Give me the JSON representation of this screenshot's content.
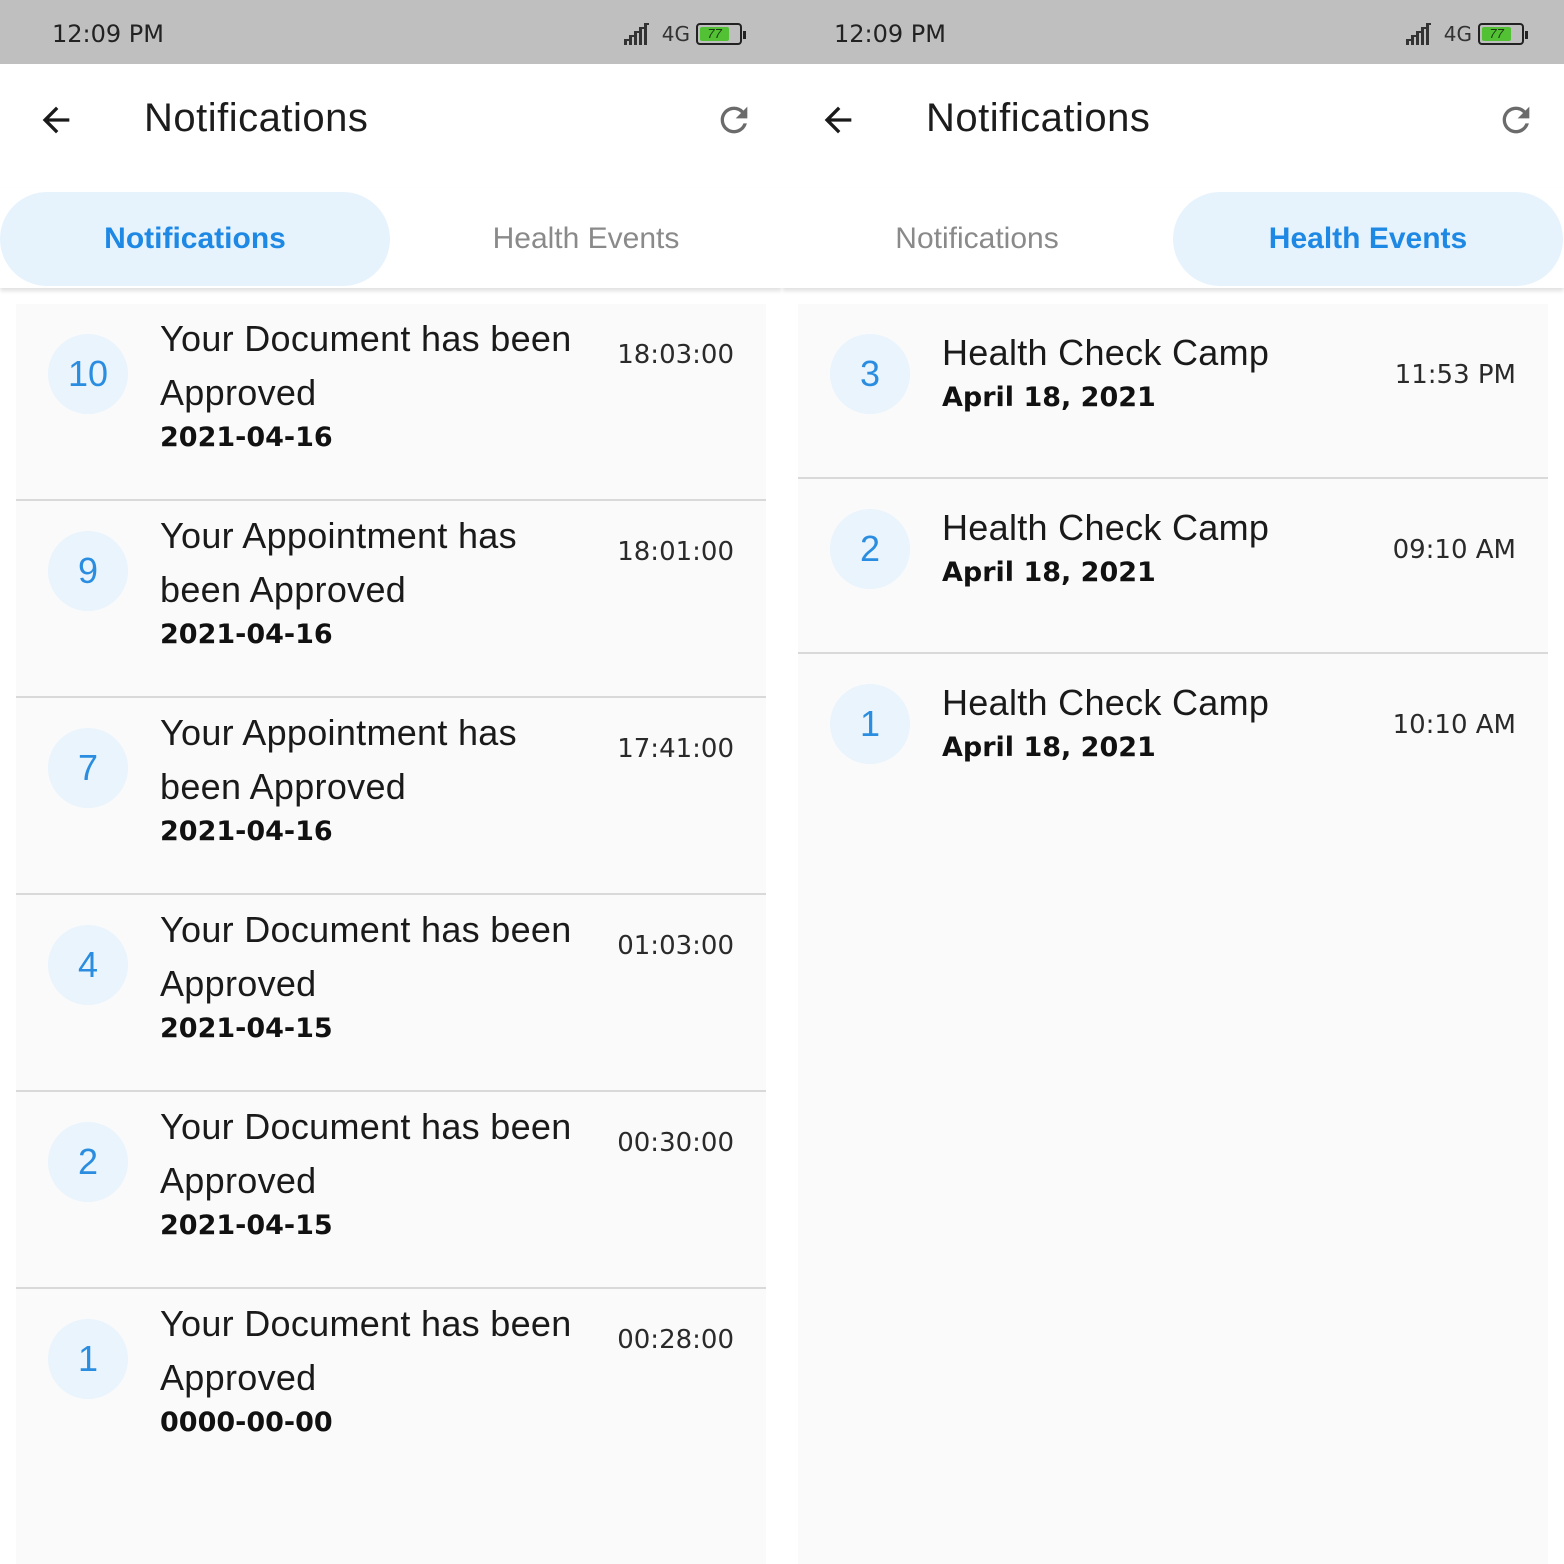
{
  "screens": [
    {
      "status": {
        "time": "12:09 PM",
        "network": "4G",
        "battery": "77"
      },
      "appbar": {
        "title": "Notifications"
      },
      "tabs": [
        {
          "label": "Notifications",
          "active": true
        },
        {
          "label": "Health Events",
          "active": false
        }
      ],
      "items": [
        {
          "number": "10",
          "title": "Your Document has been Approved",
          "date": "2021-04-16",
          "time": "18:03:00"
        },
        {
          "number": "9",
          "title": "Your Appointment has been Approved",
          "date": "2021-04-16",
          "time": "18:01:00"
        },
        {
          "number": "7",
          "title": "Your Appointment has been Approved",
          "date": "2021-04-16",
          "time": "17:41:00"
        },
        {
          "number": "4",
          "title": "Your Document has been Approved",
          "date": "2021-04-15",
          "time": "01:03:00"
        },
        {
          "number": "2",
          "title": "Your Document has been Approved",
          "date": "2021-04-15",
          "time": "00:30:00"
        },
        {
          "number": "1",
          "title": "Your Document has been Approved",
          "date": "0000-00-00",
          "time": "00:28:00"
        }
      ]
    },
    {
      "status": {
        "time": "12:09 PM",
        "network": "4G",
        "battery": "77"
      },
      "appbar": {
        "title": "Notifications"
      },
      "tabs": [
        {
          "label": "Notifications",
          "active": false
        },
        {
          "label": "Health Events",
          "active": true
        }
      ],
      "items": [
        {
          "number": "3",
          "title": "Health Check Camp",
          "date": "April 18, 2021",
          "time": "11:53 PM"
        },
        {
          "number": "2",
          "title": "Health Check Camp",
          "date": "April 18, 2021",
          "time": "09:10 AM"
        },
        {
          "number": "1",
          "title": "Health Check Camp",
          "date": "April 18, 2021",
          "time": "10:10 AM"
        }
      ]
    }
  ],
  "colors": {
    "accent": "#1e88e5",
    "active_tab_bg": "#e6f3fd",
    "badge_bg": "#e9f4fd",
    "status_bar": "#bfbfbf"
  },
  "icons": [
    "back-arrow-icon",
    "refresh-icon",
    "signal-icon",
    "battery-icon"
  ]
}
